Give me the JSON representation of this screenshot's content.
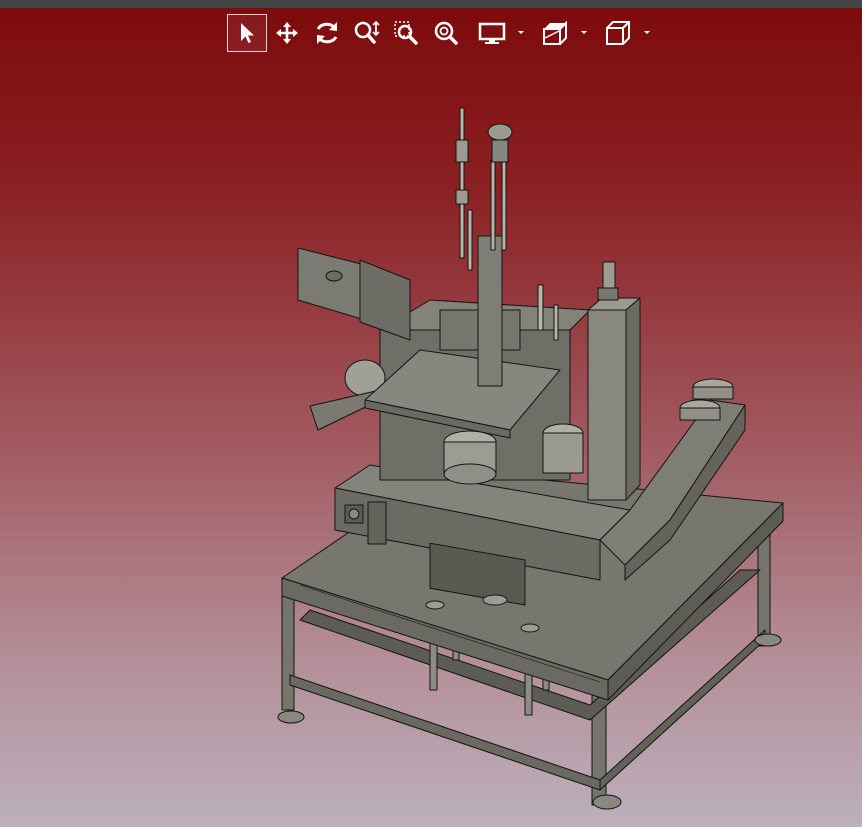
{
  "toolbar": {
    "tools": [
      {
        "icon": "select-arrow-icon",
        "active": true
      },
      {
        "icon": "pan-move-icon"
      },
      {
        "icon": "rotate-icon"
      },
      {
        "icon": "zoom-in-out-icon"
      },
      {
        "icon": "zoom-window-icon"
      },
      {
        "icon": "zoom-fit-icon"
      },
      {
        "icon": "display-mode-icon",
        "dropdown": true
      },
      {
        "icon": "section-view-icon",
        "dropdown": true
      },
      {
        "icon": "view-cube-icon",
        "dropdown": true
      }
    ]
  },
  "colors": {
    "background_top": "#7d0a0b",
    "background_bottom": "#bcb0bb",
    "model_fill": "#6e6e66",
    "model_edge": "#141414"
  }
}
